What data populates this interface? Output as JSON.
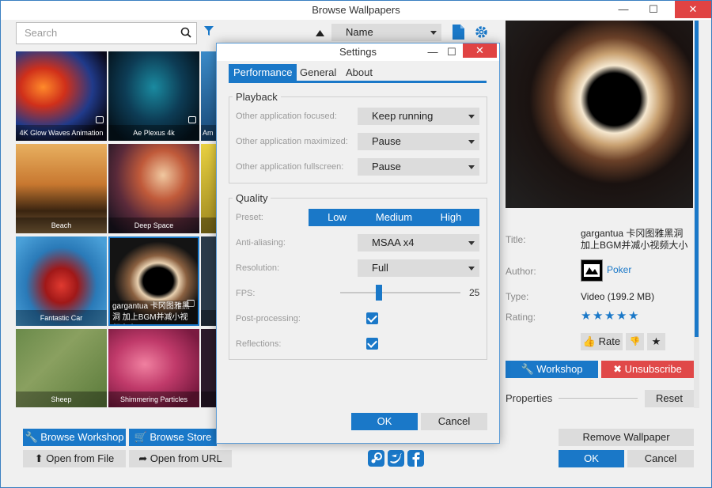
{
  "window": {
    "title": "Browse Wallpapers",
    "minimize": "—",
    "maximize": "☐",
    "close": "✕"
  },
  "search": {
    "placeholder": "Search"
  },
  "sort": {
    "value": "Name"
  },
  "tiles": [
    {
      "label": "4K Glow Waves Animation"
    },
    {
      "label": "Ae Plexus 4k"
    },
    {
      "label": "Am"
    },
    {
      "label": "Beach"
    },
    {
      "label": "Deep Space"
    },
    {
      "label": ""
    },
    {
      "label": "Fantastic Car"
    },
    {
      "label": "gargantua 卡冈图雅黑洞 加上BGM并减小视频大小"
    },
    {
      "label": ""
    },
    {
      "label": "Sheep"
    },
    {
      "label": "Shimmering Particles"
    },
    {
      "label": ""
    }
  ],
  "bottom_left": {
    "browse_workshop": "Browse Workshop",
    "browse_store": "Browse Store",
    "open_file": "Open from File",
    "open_url": "Open from URL"
  },
  "settings": {
    "title": "Settings",
    "tabs": [
      "Performance",
      "General",
      "About"
    ],
    "playback": {
      "title": "Playback",
      "focused_label": "Other application focused:",
      "focused_value": "Keep running",
      "maximized_label": "Other application maximized:",
      "maximized_value": "Pause",
      "fullscreen_label": "Other application fullscreen:",
      "fullscreen_value": "Pause"
    },
    "quality": {
      "title": "Quality",
      "preset_label": "Preset:",
      "preset_options": [
        "Low",
        "Medium",
        "High"
      ],
      "aa_label": "Anti-aliasing:",
      "aa_value": "MSAA x4",
      "res_label": "Resolution:",
      "res_value": "Full",
      "fps_label": "FPS:",
      "fps_value": "25",
      "post_label": "Post-processing:",
      "post_checked": true,
      "refl_label": "Reflections:",
      "refl_checked": true
    },
    "ok": "OK",
    "cancel": "Cancel"
  },
  "details": {
    "title_label": "Title:",
    "title_value": "gargantua 卡冈图雅黑洞 加上BGM并减小视频大小",
    "author_label": "Author:",
    "author_value": "Poker",
    "type_label": "Type:",
    "type_value": "Video (199.2 MB)",
    "rating_label": "Rating:",
    "rating_stars": 5,
    "rate_button": "Rate",
    "workshop_button": "Workshop",
    "unsubscribe_button": "Unsubscribe",
    "properties_label": "Properties",
    "reset_button": "Reset"
  },
  "bottom_right": {
    "remove": "Remove Wallpaper",
    "ok": "OK",
    "cancel": "Cancel"
  },
  "colors": {
    "accent": "#1a78c8",
    "danger": "#e04848"
  }
}
